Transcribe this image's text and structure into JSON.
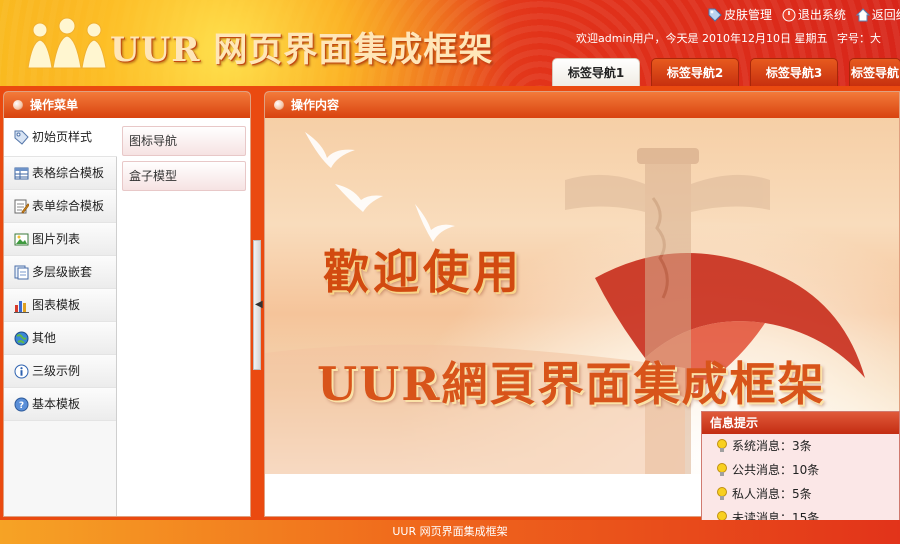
{
  "header": {
    "logo_text": "UUR 网页界面集成框架",
    "top_links": [
      {
        "label": "皮肤管理",
        "icon": "tag-icon"
      },
      {
        "label": "退出系统",
        "icon": "power-icon"
      },
      {
        "label": "返回结",
        "icon": "home-icon"
      }
    ],
    "welcome": "欢迎admin用户，今天是 2010年12月10日 星期五",
    "weather": "字号：大",
    "tabs": [
      "标签导航1",
      "标签导航2",
      "标签导航3",
      "标签导航"
    ],
    "active_tab": 0
  },
  "left_panel": {
    "title": "操作菜单",
    "menu": [
      {
        "label": "初始页样式",
        "icon": "tag-icon"
      },
      {
        "label": "表格综合模板",
        "icon": "table-icon"
      },
      {
        "label": "表单综合模板",
        "icon": "form-icon"
      },
      {
        "label": "图片列表",
        "icon": "picture-icon"
      },
      {
        "label": "多层级嵌套",
        "icon": "nested-icon"
      },
      {
        "label": "图表模板",
        "icon": "bar-chart-icon"
      },
      {
        "label": "其他",
        "icon": "globe-icon"
      },
      {
        "label": "三级示例",
        "icon": "info-icon"
      },
      {
        "label": "基本模板",
        "icon": "help-icon"
      }
    ],
    "active_menu": 0,
    "sub_items": [
      "图标导航",
      "盒子模型"
    ]
  },
  "right_panel": {
    "title": "操作内容",
    "banner_line1": "歡迎使用",
    "banner_line2": "UUR網頁界面集成框架"
  },
  "info_box": {
    "title": "信息提示",
    "items": [
      "系统消息：3条",
      "公共消息：10条",
      "私人消息：5条",
      "未读消息：15条"
    ]
  },
  "footer": {
    "text": "UUR 网页界面集成框架"
  },
  "colors": {
    "accent": "#e2331a",
    "highlight": "#f7b51d"
  }
}
